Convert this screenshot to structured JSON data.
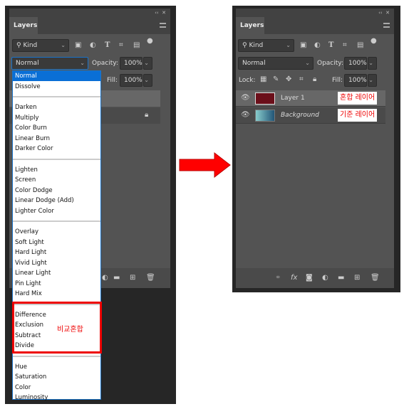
{
  "left_panel": {
    "collapse": "‹‹",
    "close": "✕",
    "tab": "Layers",
    "filter": {
      "label": "Kind"
    },
    "blend_mode": "Normal",
    "opacity_label": "Opacity:",
    "opacity": "100%",
    "fill_label": "Fill:",
    "fill": "100%",
    "dropdown": {
      "groups": [
        [
          "Normal",
          "Dissolve"
        ],
        [
          "Darken",
          "Multiply",
          "Color Burn",
          "Linear Burn",
          "Darker Color"
        ],
        [
          "Lighten",
          "Screen",
          "Color Dodge",
          "Linear Dodge (Add)",
          "Lighter Color"
        ],
        [
          "Overlay",
          "Soft Light",
          "Hard Light",
          "Vivid Light",
          "Linear Light",
          "Pin Light",
          "Hard Mix"
        ],
        [
          "Difference",
          "Exclusion",
          "Subtract",
          "Divide"
        ],
        [
          "Hue",
          "Saturation",
          "Color",
          "Luminosity"
        ]
      ],
      "selected": "Normal"
    },
    "annotation": "비교혼합"
  },
  "right_panel": {
    "collapse": "‹‹",
    "close": "✕",
    "tab": "Layers",
    "filter": {
      "label": "Kind"
    },
    "blend_mode": "Normal",
    "opacity_label": "Opacity:",
    "opacity": "100%",
    "lock_label": "Lock:",
    "fill_label": "Fill:",
    "fill": "100%",
    "layers": [
      {
        "name": "Layer 1",
        "annotation": "혼합 레이어",
        "italic": false
      },
      {
        "name": "Background",
        "annotation": "기준 레이어",
        "italic": true
      }
    ]
  },
  "colors": {
    "accent": "#0a6fd6",
    "annotation": "#ee0000",
    "panel": "#535353"
  }
}
